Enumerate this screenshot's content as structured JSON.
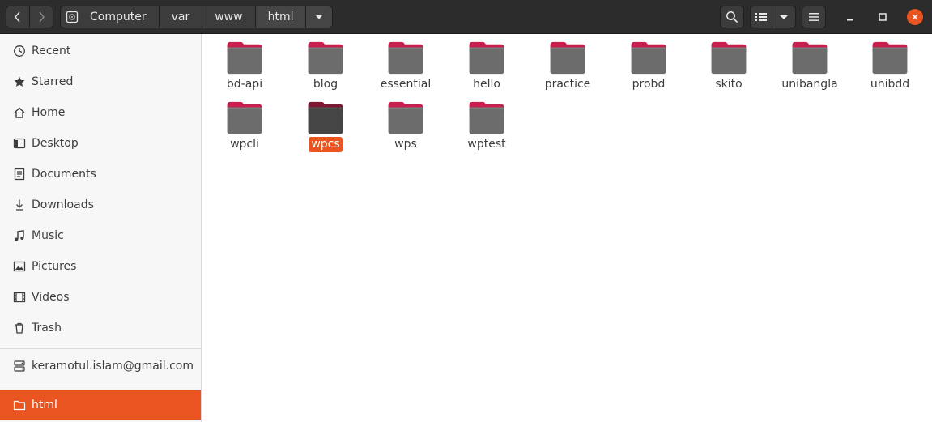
{
  "header": {
    "path": [
      "Computer",
      "var",
      "www",
      "html"
    ],
    "icons": {
      "back": "chevron-left-icon",
      "forward": "chevron-right-icon",
      "disk": "disk-icon",
      "search": "search-icon",
      "view": "list-view-icon",
      "view_options": "chevron-down-icon",
      "menu": "hamburger-menu-icon",
      "minimize": "minimize-icon",
      "maximize": "maximize-icon",
      "close": "close-icon"
    }
  },
  "sidebar": {
    "places": [
      {
        "label": "Recent",
        "icon": "clock-icon"
      },
      {
        "label": "Starred",
        "icon": "star-icon"
      },
      {
        "label": "Home",
        "icon": "home-icon"
      },
      {
        "label": "Desktop",
        "icon": "desktop-icon"
      },
      {
        "label": "Documents",
        "icon": "document-icon"
      },
      {
        "label": "Downloads",
        "icon": "download-icon"
      },
      {
        "label": "Music",
        "icon": "music-icon"
      },
      {
        "label": "Pictures",
        "icon": "picture-icon"
      },
      {
        "label": "Videos",
        "icon": "video-icon"
      },
      {
        "label": "Trash",
        "icon": "trash-icon"
      }
    ],
    "account": {
      "label": "keramotul.islam@gmail.com",
      "icon": "network-drive-icon"
    },
    "bookmark": {
      "label": "html",
      "icon": "folder-icon"
    }
  },
  "files": [
    {
      "name": "bd-api",
      "selected": false
    },
    {
      "name": "blog",
      "selected": false
    },
    {
      "name": "essential",
      "selected": false
    },
    {
      "name": "hello",
      "selected": false
    },
    {
      "name": "practice",
      "selected": false
    },
    {
      "name": "probd",
      "selected": false
    },
    {
      "name": "skito",
      "selected": false
    },
    {
      "name": "unibangla",
      "selected": false
    },
    {
      "name": "unibdd",
      "selected": false
    },
    {
      "name": "wpcli",
      "selected": false
    },
    {
      "name": "wpcs",
      "selected": true
    },
    {
      "name": "wps",
      "selected": false
    },
    {
      "name": "wptest",
      "selected": false
    }
  ],
  "colors": {
    "accent": "#e95420",
    "folder_tab": "#c7204e",
    "folder_body": "#6c6c6c",
    "header": "#2c2c2c"
  }
}
